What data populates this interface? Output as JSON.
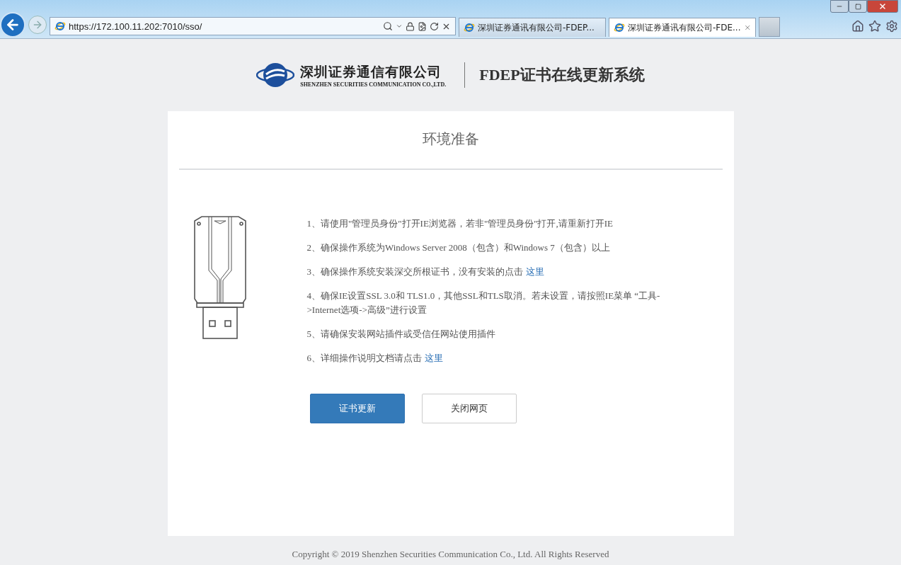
{
  "browser": {
    "address": "https://172.100.11.202:7010/sso/",
    "tabs": [
      {
        "label": "深圳证券通讯有限公司-FDEP...",
        "selected": false
      },
      {
        "label": "深圳证券通讯有限公司-FDE...",
        "selected": true
      }
    ]
  },
  "header": {
    "company_cn": "深圳证券通信有限公司",
    "company_en": "SHENZHEN SECURITIES COMMUNICATION CO.,LTD.",
    "system_title": "FDEP证书在线更新系统"
  },
  "card": {
    "title": "环境准备",
    "steps": [
      {
        "text": "1、请使用\"管理员身份\"打开IE浏览器，若非\"管理员身份\"打开,请重新打开IE"
      },
      {
        "text": "2、确保操作系统为Windows Server 2008（包含）和Windows 7（包含）以上"
      },
      {
        "text": "3、确保操作系统安装深交所根证书，没有安装的点击",
        "link": "这里"
      },
      {
        "text": "4、确保IE设置SSL 3.0和 TLS1.0，其他SSL和TLS取消。若未设置，请按照IE菜单 “工具->Internet选项->高级”进行设置"
      },
      {
        "text": "5、请确保安装网站插件或受信任网站使用插件"
      },
      {
        "text": "6、详细操作说明文档请点击",
        "link": "这里"
      }
    ],
    "buttons": [
      {
        "label": "证书更新",
        "kind": "primary"
      },
      {
        "label": "关闭网页",
        "kind": "secondary"
      }
    ]
  },
  "footer": "Copyright © 2019 Shenzhen Securities Communication Co., Ltd. All Rights Reserved"
}
